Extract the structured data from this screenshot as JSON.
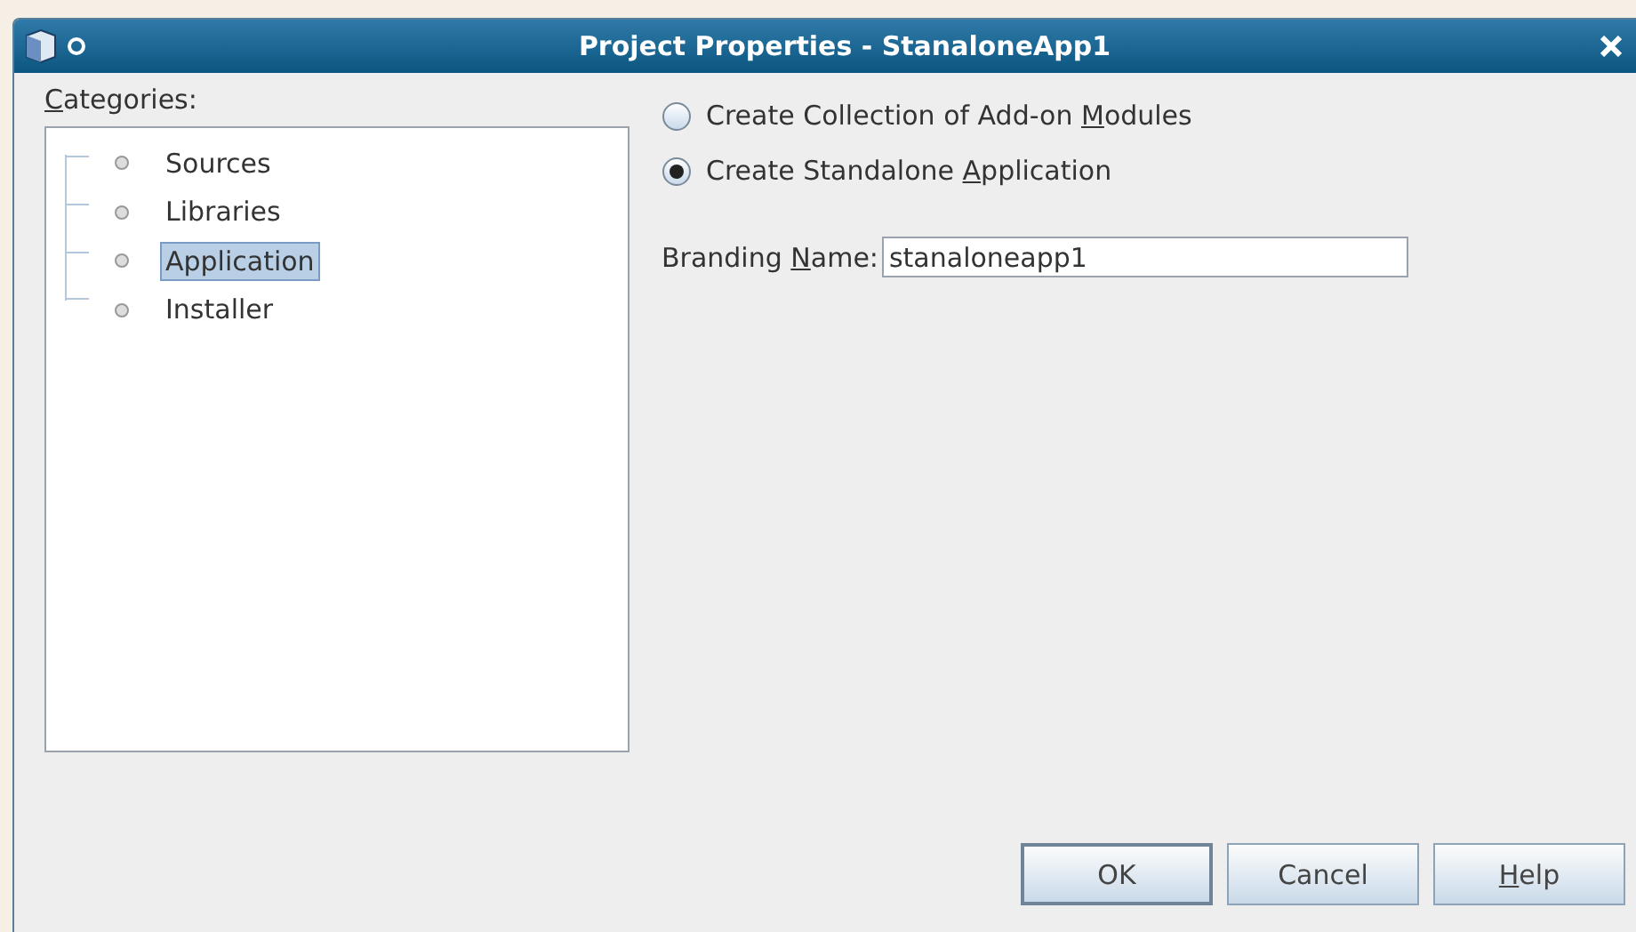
{
  "window": {
    "title": "Project Properties - StanaloneApp1"
  },
  "categories": {
    "label": {
      "key": "C",
      "after": "ategories:"
    },
    "items": [
      {
        "label": "Sources",
        "selected": false
      },
      {
        "label": "Libraries",
        "selected": false
      },
      {
        "label": "Application",
        "selected": true
      },
      {
        "label": "Installer",
        "selected": false
      }
    ]
  },
  "options": [
    {
      "label": {
        "before": "Create Collection of Add-on ",
        "key": "M",
        "after": "odules"
      },
      "selected": false
    },
    {
      "label": {
        "before": "Create Standalone ",
        "key": "A",
        "after": "pplication"
      },
      "selected": true
    }
  ],
  "branding": {
    "label": {
      "before": "Branding ",
      "key": "N",
      "after": "ame:"
    },
    "value": "stanaloneapp1"
  },
  "buttons": [
    {
      "label": {
        "after": "OK"
      },
      "default": true
    },
    {
      "label": {
        "after": "Cancel"
      },
      "default": false
    },
    {
      "label": {
        "key": "H",
        "after": "elp"
      },
      "default": false
    }
  ]
}
